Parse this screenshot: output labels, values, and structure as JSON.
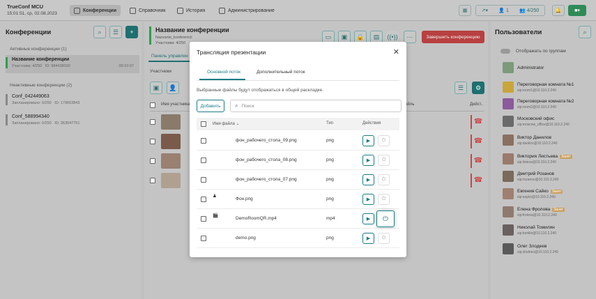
{
  "app": {
    "title": "TrueConf MCU",
    "datetime": "15:01:51, ср, 02.08.2023"
  },
  "nav": [
    {
      "label": "Конференции",
      "icon": "group-icon"
    },
    {
      "label": "Справочник",
      "icon": "book-icon"
    },
    {
      "label": "История",
      "icon": "history-icon"
    },
    {
      "label": "Администрирование",
      "icon": "admin-icon"
    }
  ],
  "top_right": {
    "users_count": "1",
    "load": "4/250"
  },
  "left": {
    "title": "Конференции",
    "active_section": "Активные конференции (1)",
    "inactive_section": "Неактивные конференции (2)",
    "active": [
      {
        "name": "Название конференции",
        "participants": "Участники: 4/250",
        "id": "ID: 984438030",
        "time": "00:10:07"
      }
    ],
    "inactive": [
      {
        "name": "Conf_042449063",
        "planned": "Запланировано: 0/250",
        "id": "ID: 179653843"
      },
      {
        "name": "Conf_588994340",
        "planned": "Запланировано: 0/250",
        "id": "ID: 363047751"
      }
    ]
  },
  "center": {
    "title": "Название конференции",
    "subtitle": "Nazvanie_konferencii",
    "participants": "Участники: 4/250",
    "end_button": "Завершить конференцию",
    "tab": "Панель управлен",
    "section": "Участники",
    "col_name": "Имя участника",
    "col_actions": "Дейст..",
    "col_partial": "ойль"
  },
  "users": {
    "title": "Пользователи",
    "toggle_label": "Отображать по группам",
    "list": [
      {
        "name": "Administrator",
        "email": "",
        "badge": "",
        "color": "#7a9a7a"
      },
      {
        "name": "Переговорная комната №1",
        "email": "sip:room1@10.110.2.240",
        "badge": "",
        "color": "#c9a63a"
      },
      {
        "name": "Переговорная комната №2",
        "email": "sip:room2@10.110.2.240",
        "badge": "",
        "color": "#8a5a9a"
      },
      {
        "name": "Московский офис",
        "email": "sip:moscow_office@10.110.2.240",
        "badge": "",
        "color": "#6a6a6a"
      },
      {
        "name": "Виктор Данилов",
        "email": "sip:danilov@10.110.2.240",
        "badge": "",
        "color": "#8a7060"
      },
      {
        "name": "Виктория Листьева",
        "email": "sip:listeva@10.110.2.240",
        "badge": "Занят",
        "color": "#9a7a6a"
      },
      {
        "name": "Дмитрий Розанов",
        "email": "sip:rozanov@10.110.2.240",
        "badge": "",
        "color": "#7a6a5a"
      },
      {
        "name": "Евгения Сайко",
        "email": "sip:sayko@10.110.2.240",
        "badge": "Занят",
        "color": "#a08070"
      },
      {
        "name": "Елена Фролова",
        "email": "sip:frolova@10.110.2.240",
        "badge": "Занят",
        "color": "#907a70"
      },
      {
        "name": "Николай Томилин",
        "email": "sip:tomilin@10.110.2.240",
        "badge": "",
        "color": "#6a6060"
      },
      {
        "name": "Олег Злодеев",
        "email": "sip:zlodeev@10.110.2.240",
        "badge": "",
        "color": "#5a5a5a"
      }
    ]
  },
  "modal": {
    "title": "Трансляция презентации",
    "tab_main": "Основной поток",
    "tab_extra": "Дополнительный поток",
    "hint": "Выбранные файлы будут отображаться в общей раскладке.",
    "add_button": "Добавить",
    "search_placeholder": "Поиск",
    "col_name": "Имя файла",
    "col_type": "Тип",
    "col_actions": "Действия",
    "files": [
      {
        "name": "фон_рабочего_стола_09.png",
        "type": "png",
        "thumb": "cyan"
      },
      {
        "name": "фон_рабочего_стола_08.png",
        "type": "png",
        "thumb": "cyan"
      },
      {
        "name": "фон_рабочего_стола_07.png",
        "type": "png",
        "thumb": "cyan"
      },
      {
        "name": "Фон.png",
        "type": "png",
        "thumb": "logo"
      },
      {
        "name": "DemoRoomQR.mp4",
        "type": "mp4",
        "thumb": "video"
      },
      {
        "name": "demo.png",
        "type": "png",
        "thumb": "photo"
      }
    ]
  },
  "colors": {
    "accent": "#1a7c87",
    "danger": "#d33",
    "active_conf_border": "#2e9e4a"
  }
}
